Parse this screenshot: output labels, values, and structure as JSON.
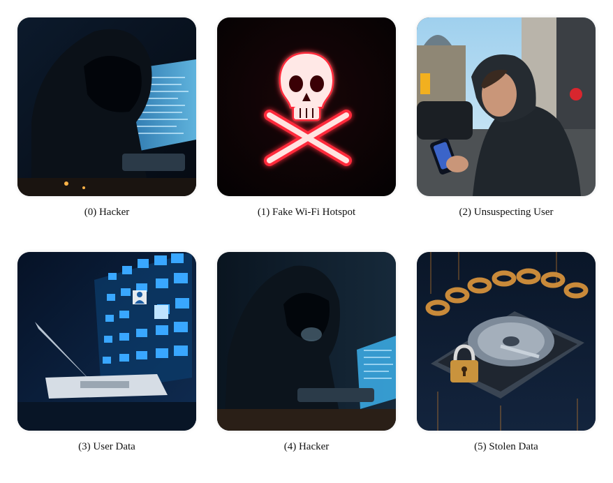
{
  "cards": [
    {
      "caption": "(0) Hacker",
      "icon": "hooded-hacker-laptop-image"
    },
    {
      "caption": "(1) Fake Wi-Fi Hotspot",
      "icon": "skull-crossbones-image"
    },
    {
      "caption": "(2) Unsuspecting User",
      "icon": "user-with-phone-street-image"
    },
    {
      "caption": "(3) User Data",
      "icon": "laptop-data-stream-image"
    },
    {
      "caption": "(4) Hacker",
      "icon": "hooded-hacker-laptop-image"
    },
    {
      "caption": "(5) Stolen Data",
      "icon": "hard-drive-chain-lock-image"
    }
  ],
  "colors": {
    "background": "#ffffff",
    "skull_glow": "#ff2a3a",
    "cyan_accent": "#4fc3ff",
    "amber_accent": "#ff9a2a"
  }
}
